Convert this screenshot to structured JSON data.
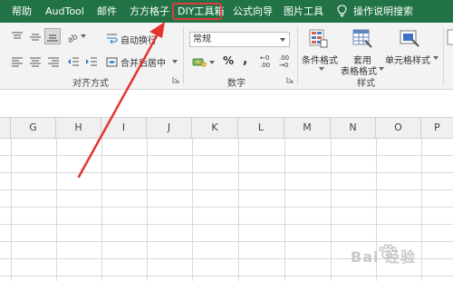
{
  "tabs": [
    "帮助",
    "AudTool",
    "邮件",
    "方方格子",
    "DIY工具箱",
    "公式向导",
    "图片工具",
    "操作说明搜索"
  ],
  "alignment": {
    "wrap_text_label": "自动换行",
    "merge_center_label": "合并后居中",
    "group_label": "对齐方式"
  },
  "number": {
    "format_value": "常规",
    "percent_symbol": "%",
    "comma_symbol": ",",
    "increase_decimal": "←0 .00",
    "decrease_decimal": ".00 →0",
    "group_label": "数字"
  },
  "styles": {
    "conditional_format_label": "条件格式",
    "format_table_line1": "套用",
    "format_table_line2": "表格格式",
    "cell_styles_label": "单元格样式",
    "group_label": "样式"
  },
  "columns": [
    "G",
    "H",
    "I",
    "J",
    "K",
    "L",
    "M",
    "N",
    "O",
    "P"
  ],
  "watermark_text": "Bai 经验",
  "colors": {
    "tab_bg": "#217346",
    "highlight": "#e23b3b",
    "arrow": "#e5342f",
    "grid": "#d9d9d9"
  }
}
